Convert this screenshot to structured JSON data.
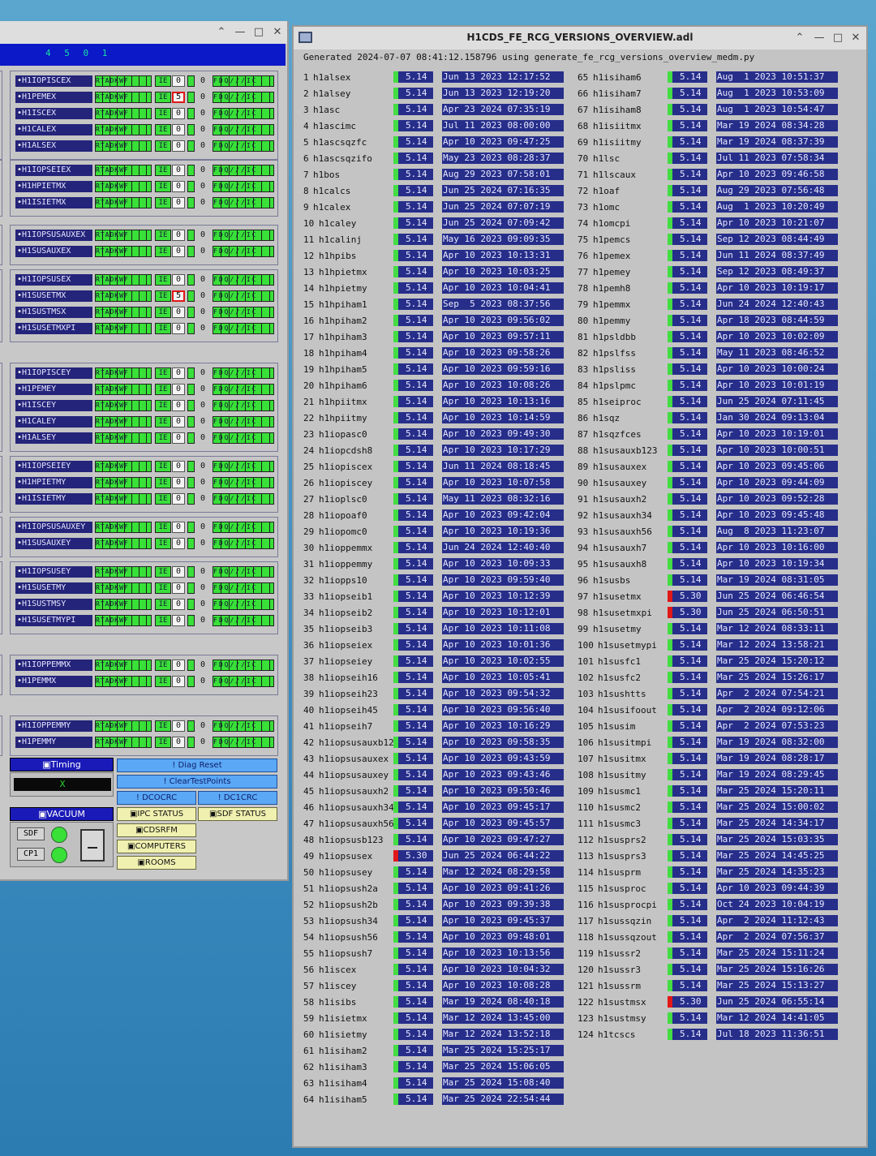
{
  "left_panel": {
    "header_digits": "4 5 0 1",
    "lamp_text": "RTADKWF",
    "ie_text": "IE",
    "rt_text": "FDQ///IC",
    "groups": [
      {
        "rows": [
          {
            "name": "H1IOPISCEX",
            "count": "0",
            "zero": "0"
          },
          {
            "name": "H1PEMEX",
            "count": "5",
            "zero": "0",
            "alert": true
          },
          {
            "name": "H1ISCEX",
            "count": "0",
            "zero": "0"
          },
          {
            "name": "H1CALEX",
            "count": "0",
            "zero": "0"
          },
          {
            "name": "H1ALSEX",
            "count": "0",
            "zero": "0"
          }
        ]
      },
      {
        "rows": [
          {
            "name": "H1IOPSEIEX",
            "count": "0",
            "zero": "0"
          },
          {
            "name": "H1HPIETMX",
            "count": "0",
            "zero": "0"
          },
          {
            "name": "H1ISIETMX",
            "count": "0",
            "zero": "0"
          }
        ]
      },
      {
        "rows": [
          {
            "name": "H1IOPSUSAUXEX",
            "count": "0",
            "zero": "0"
          },
          {
            "name": "H1SUSAUXEX",
            "count": "0",
            "zero": "0"
          }
        ]
      },
      {
        "rows": [
          {
            "name": "H1IOPSUSEX",
            "count": "0",
            "zero": "0"
          },
          {
            "name": "H1SUSETMX",
            "count": "5",
            "zero": "0",
            "alert": true
          },
          {
            "name": "H1SUSTMSX",
            "count": "0",
            "zero": "0"
          },
          {
            "name": "H1SUSETMXPI",
            "count": "0",
            "zero": "0"
          }
        ]
      },
      {
        "rows": [
          {
            "name": "H1IOPISCEY",
            "count": "0",
            "zero": "0"
          },
          {
            "name": "H1PEMEY",
            "count": "0",
            "zero": "0"
          },
          {
            "name": "H1ISCEY",
            "count": "0",
            "zero": "0"
          },
          {
            "name": "H1CALEY",
            "count": "0",
            "zero": "0"
          },
          {
            "name": "H1ALSEY",
            "count": "0",
            "zero": "0"
          }
        ]
      },
      {
        "rows": [
          {
            "name": "H1IOPSEIEY",
            "count": "0",
            "zero": "0"
          },
          {
            "name": "H1HPIETMY",
            "count": "0",
            "zero": "0"
          },
          {
            "name": "H1ISIETMY",
            "count": "0",
            "zero": "0"
          }
        ]
      },
      {
        "rows": [
          {
            "name": "H1IOPSUSAUXEY",
            "count": "0",
            "zero": "0"
          },
          {
            "name": "H1SUSAUXEY",
            "count": "0",
            "zero": "0"
          }
        ]
      },
      {
        "rows": [
          {
            "name": "H1IOPSUSEY",
            "count": "0",
            "zero": "0"
          },
          {
            "name": "H1SUSETMY",
            "count": "0",
            "zero": "0"
          },
          {
            "name": "H1SUSTMSY",
            "count": "0",
            "zero": "0"
          },
          {
            "name": "H1SUSETMYPI",
            "count": "0",
            "zero": "0"
          }
        ]
      },
      {
        "rows": [
          {
            "name": "H1IOPPEMMX",
            "count": "0",
            "zero": "0"
          },
          {
            "name": "H1PEMMX",
            "count": "0",
            "zero": "0"
          }
        ]
      },
      {
        "rows": [
          {
            "name": "H1IOPPEMMY",
            "count": "0",
            "zero": "0"
          },
          {
            "name": "H1PEMMY",
            "count": "0",
            "zero": "0"
          }
        ]
      }
    ],
    "timing_label": "Timing",
    "timing_value": "X",
    "vacuum_label": "VACUUM",
    "sdf_label": "SDF",
    "cp1_label": "CP1",
    "buttons": {
      "diag_reset": "! Diag Reset",
      "clear_test_points": "! ClearTestPoints",
      "dcocrc": "! DCOCRC",
      "dc1crc": "! DC1CRC",
      "ipc_status": "IPC STATUS",
      "sdf_status": "SDF STATUS",
      "cdsrfm": "CDSRFM",
      "computers": "COMPUTERS",
      "rooms": "ROOMS"
    }
  },
  "window": {
    "title": "H1CDS_FE_RCG_VERSIONS_OVERVIEW.adl",
    "generated": "Generated 2024-07-07 08:41:12.158796 using generate_fe_rcg_versions_overview_medm.py"
  },
  "models_left": [
    [
      "1",
      "h1alsex",
      "5.14",
      "Jun 13 2023 12:17:52"
    ],
    [
      "2",
      "h1alsey",
      "5.14",
      "Jun 13 2023 12:19:20"
    ],
    [
      "3",
      "h1asc",
      "5.14",
      "Apr 23 2024 07:35:19"
    ],
    [
      "4",
      "h1ascimc",
      "5.14",
      "Jul 11 2023 08:00:00"
    ],
    [
      "5",
      "h1ascsqzfc",
      "5.14",
      "Apr 10 2023 09:47:25"
    ],
    [
      "6",
      "h1ascsqzifo",
      "5.14",
      "May 23 2023 08:28:37"
    ],
    [
      "7",
      "h1bos",
      "5.14",
      "Aug 29 2023 07:58:01"
    ],
    [
      "8",
      "h1calcs",
      "5.14",
      "Jun 25 2024 07:16:35"
    ],
    [
      "9",
      "h1calex",
      "5.14",
      "Jun 25 2024 07:07:19"
    ],
    [
      "10",
      "h1caley",
      "5.14",
      "Jun 25 2024 07:09:42"
    ],
    [
      "11",
      "h1calinj",
      "5.14",
      "May 16 2023 09:09:35"
    ],
    [
      "12",
      "h1hpibs",
      "5.14",
      "Apr 10 2023 10:13:31"
    ],
    [
      "13",
      "h1hpietmx",
      "5.14",
      "Apr 10 2023 10:03:25"
    ],
    [
      "14",
      "h1hpietmy",
      "5.14",
      "Apr 10 2023 10:04:41"
    ],
    [
      "15",
      "h1hpiham1",
      "5.14",
      "Sep  5 2023 08:37:56"
    ],
    [
      "16",
      "h1hpiham2",
      "5.14",
      "Apr 10 2023 09:56:02"
    ],
    [
      "17",
      "h1hpiham3",
      "5.14",
      "Apr 10 2023 09:57:11"
    ],
    [
      "18",
      "h1hpiham4",
      "5.14",
      "Apr 10 2023 09:58:26"
    ],
    [
      "19",
      "h1hpiham5",
      "5.14",
      "Apr 10 2023 09:59:16"
    ],
    [
      "20",
      "h1hpiham6",
      "5.14",
      "Apr 10 2023 10:08:26"
    ],
    [
      "21",
      "h1hpiitmx",
      "5.14",
      "Apr 10 2023 10:13:16"
    ],
    [
      "22",
      "h1hpiitmy",
      "5.14",
      "Apr 10 2023 10:14:59"
    ],
    [
      "23",
      "h1iopasc0",
      "5.14",
      "Apr 10 2023 09:49:30"
    ],
    [
      "24",
      "h1iopcdsh8",
      "5.14",
      "Apr 10 2023 10:17:29"
    ],
    [
      "25",
      "h1iopiscex",
      "5.14",
      "Jun 11 2024 08:18:45"
    ],
    [
      "26",
      "h1iopiscey",
      "5.14",
      "Apr 10 2023 10:07:58"
    ],
    [
      "27",
      "h1ioplsc0",
      "5.14",
      "May 11 2023 08:32:16"
    ],
    [
      "28",
      "h1iopoaf0",
      "5.14",
      "Apr 10 2023 09:42:04"
    ],
    [
      "29",
      "h1iopomc0",
      "5.14",
      "Apr 10 2023 10:19:36"
    ],
    [
      "30",
      "h1ioppemmx",
      "5.14",
      "Jun 24 2024 12:40:40"
    ],
    [
      "31",
      "h1ioppemmy",
      "5.14",
      "Apr 10 2023 10:09:33"
    ],
    [
      "32",
      "h1iopps10",
      "5.14",
      "Apr 10 2023 09:59:40"
    ],
    [
      "33",
      "h1iopseib1",
      "5.14",
      "Apr 10 2023 10:12:39"
    ],
    [
      "34",
      "h1iopseib2",
      "5.14",
      "Apr 10 2023 10:12:01"
    ],
    [
      "35",
      "h1iopseib3",
      "5.14",
      "Apr 10 2023 10:11:08"
    ],
    [
      "36",
      "h1iopseiex",
      "5.14",
      "Apr 10 2023 10:01:36"
    ],
    [
      "37",
      "h1iopseiey",
      "5.14",
      "Apr 10 2023 10:02:55"
    ],
    [
      "38",
      "h1iopseih16",
      "5.14",
      "Apr 10 2023 10:05:41"
    ],
    [
      "39",
      "h1iopseih23",
      "5.14",
      "Apr 10 2023 09:54:32"
    ],
    [
      "40",
      "h1iopseih45",
      "5.14",
      "Apr 10 2023 09:56:40"
    ],
    [
      "41",
      "h1iopseih7",
      "5.14",
      "Apr 10 2023 10:16:29"
    ],
    [
      "42",
      "h1iopsusauxb123",
      "5.14",
      "Apr 10 2023 09:58:35"
    ],
    [
      "43",
      "h1iopsusauxex",
      "5.14",
      "Apr 10 2023 09:43:59"
    ],
    [
      "44",
      "h1iopsusauxey",
      "5.14",
      "Apr 10 2023 09:43:46"
    ],
    [
      "45",
      "h1iopsusauxh2",
      "5.14",
      "Apr 10 2023 09:50:46"
    ],
    [
      "46",
      "h1iopsusauxh34",
      "5.14",
      "Apr 10 2023 09:45:17"
    ],
    [
      "47",
      "h1iopsusauxh56",
      "5.14",
      "Apr 10 2023 09:45:57"
    ],
    [
      "48",
      "h1iopsusb123",
      "5.14",
      "Apr 10 2023 09:47:27"
    ],
    [
      "49",
      "h1iopsusex",
      "5.30",
      "Jun 25 2024 06:44:22"
    ],
    [
      "50",
      "h1iopsusey",
      "5.14",
      "Mar 12 2024 08:29:58"
    ],
    [
      "51",
      "h1iopsush2a",
      "5.14",
      "Apr 10 2023 09:41:26"
    ],
    [
      "52",
      "h1iopsush2b",
      "5.14",
      "Apr 10 2023 09:39:38"
    ],
    [
      "53",
      "h1iopsush34",
      "5.14",
      "Apr 10 2023 09:45:37"
    ],
    [
      "54",
      "h1iopsush56",
      "5.14",
      "Apr 10 2023 09:48:01"
    ],
    [
      "55",
      "h1iopsush7",
      "5.14",
      "Apr 10 2023 10:13:56"
    ],
    [
      "56",
      "h1iscex",
      "5.14",
      "Apr 10 2023 10:04:32"
    ],
    [
      "57",
      "h1iscey",
      "5.14",
      "Apr 10 2023 10:08:28"
    ],
    [
      "58",
      "h1isibs",
      "5.14",
      "Mar 19 2024 08:40:18"
    ],
    [
      "59",
      "h1isietmx",
      "5.14",
      "Mar 12 2024 13:45:00"
    ],
    [
      "60",
      "h1isietmy",
      "5.14",
      "Mar 12 2024 13:52:18"
    ],
    [
      "61",
      "h1isiham2",
      "5.14",
      "Mar 25 2024 15:25:17"
    ],
    [
      "62",
      "h1isiham3",
      "5.14",
      "Mar 25 2024 15:06:05"
    ],
    [
      "63",
      "h1isiham4",
      "5.14",
      "Mar 25 2024 15:08:40"
    ],
    [
      "64",
      "h1isiham5",
      "5.14",
      "Mar 25 2024 22:54:44"
    ]
  ],
  "models_right": [
    [
      "65",
      "h1isiham6",
      "5.14",
      "Aug  1 2023 10:51:37"
    ],
    [
      "66",
      "h1isiham7",
      "5.14",
      "Aug  1 2023 10:53:09"
    ],
    [
      "67",
      "h1isiham8",
      "5.14",
      "Aug  1 2023 10:54:47"
    ],
    [
      "68",
      "h1isiitmx",
      "5.14",
      "Mar 19 2024 08:34:28"
    ],
    [
      "69",
      "h1isiitmy",
      "5.14",
      "Mar 19 2024 08:37:39"
    ],
    [
      "70",
      "h1lsc",
      "5.14",
      "Jul 11 2023 07:58:34"
    ],
    [
      "71",
      "h1lscaux",
      "5.14",
      "Apr 10 2023 09:46:58"
    ],
    [
      "72",
      "h1oaf",
      "5.14",
      "Aug 29 2023 07:56:48"
    ],
    [
      "73",
      "h1omc",
      "5.14",
      "Aug  1 2023 10:20:49"
    ],
    [
      "74",
      "h1omcpi",
      "5.14",
      "Apr 10 2023 10:21:07"
    ],
    [
      "75",
      "h1pemcs",
      "5.14",
      "Sep 12 2023 08:44:49"
    ],
    [
      "76",
      "h1pemex",
      "5.14",
      "Jun 11 2024 08:37:49"
    ],
    [
      "77",
      "h1pemey",
      "5.14",
      "Sep 12 2023 08:49:37"
    ],
    [
      "78",
      "h1pemh8",
      "5.14",
      "Apr 10 2023 10:19:17"
    ],
    [
      "79",
      "h1pemmx",
      "5.14",
      "Jun 24 2024 12:40:43"
    ],
    [
      "80",
      "h1pemmy",
      "5.14",
      "Apr 18 2023 08:44:59"
    ],
    [
      "81",
      "h1psldbb",
      "5.14",
      "Apr 10 2023 10:02:09"
    ],
    [
      "82",
      "h1pslfss",
      "5.14",
      "May 11 2023 08:46:52"
    ],
    [
      "83",
      "h1psliss",
      "5.14",
      "Apr 10 2023 10:00:24"
    ],
    [
      "84",
      "h1pslpmc",
      "5.14",
      "Apr 10 2023 10:01:19"
    ],
    [
      "85",
      "h1seiproc",
      "5.14",
      "Jun 25 2024 07:11:45"
    ],
    [
      "86",
      "h1sqz",
      "5.14",
      "Jan 30 2024 09:13:04"
    ],
    [
      "87",
      "h1sqzfces",
      "5.14",
      "Apr 10 2023 10:19:01"
    ],
    [
      "88",
      "h1susauxb123",
      "5.14",
      "Apr 10 2023 10:00:51"
    ],
    [
      "89",
      "h1susauxex",
      "5.14",
      "Apr 10 2023 09:45:06"
    ],
    [
      "90",
      "h1susauxey",
      "5.14",
      "Apr 10 2023 09:44:09"
    ],
    [
      "91",
      "h1susauxh2",
      "5.14",
      "Apr 10 2023 09:52:28"
    ],
    [
      "92",
      "h1susauxh34",
      "5.14",
      "Apr 10 2023 09:45:48"
    ],
    [
      "93",
      "h1susauxh56",
      "5.14",
      "Aug  8 2023 11:23:07"
    ],
    [
      "94",
      "h1susauxh7",
      "5.14",
      "Apr 10 2023 10:16:00"
    ],
    [
      "95",
      "h1susauxh8",
      "5.14",
      "Apr 10 2023 10:19:34"
    ],
    [
      "96",
      "h1susbs",
      "5.14",
      "Mar 19 2024 08:31:05"
    ],
    [
      "97",
      "h1susetmx",
      "5.30",
      "Jun 25 2024 06:46:54"
    ],
    [
      "98",
      "h1susetmxpi",
      "5.30",
      "Jun 25 2024 06:50:51"
    ],
    [
      "99",
      "h1susetmy",
      "5.14",
      "Mar 12 2024 08:33:11"
    ],
    [
      "100",
      "h1susetmypi",
      "5.14",
      "Mar 12 2024 13:58:21"
    ],
    [
      "101",
      "h1susfc1",
      "5.14",
      "Mar 25 2024 15:20:12"
    ],
    [
      "102",
      "h1susfc2",
      "5.14",
      "Mar 25 2024 15:26:17"
    ],
    [
      "103",
      "h1sushtts",
      "5.14",
      "Apr  2 2024 07:54:21"
    ],
    [
      "104",
      "h1susifoout",
      "5.14",
      "Apr  2 2024 09:12:06"
    ],
    [
      "105",
      "h1susim",
      "5.14",
      "Apr  2 2024 07:53:23"
    ],
    [
      "106",
      "h1susitmpi",
      "5.14",
      "Mar 19 2024 08:32:00"
    ],
    [
      "107",
      "h1susitmx",
      "5.14",
      "Mar 19 2024 08:28:17"
    ],
    [
      "108",
      "h1susitmy",
      "5.14",
      "Mar 19 2024 08:29:45"
    ],
    [
      "109",
      "h1susmc1",
      "5.14",
      "Mar 25 2024 15:20:11"
    ],
    [
      "110",
      "h1susmc2",
      "5.14",
      "Mar 25 2024 15:00:02"
    ],
    [
      "111",
      "h1susmc3",
      "5.14",
      "Mar 25 2024 14:34:17"
    ],
    [
      "112",
      "h1susprs2",
      "5.14",
      "Mar 25 2024 15:03:35"
    ],
    [
      "113",
      "h1susprs3",
      "5.14",
      "Mar 25 2024 14:45:25"
    ],
    [
      "114",
      "h1susprm",
      "5.14",
      "Mar 25 2024 14:35:23"
    ],
    [
      "115",
      "h1susproc",
      "5.14",
      "Apr 10 2023 09:44:39"
    ],
    [
      "116",
      "h1susprocpi",
      "5.14",
      "Oct 24 2023 10:04:19"
    ],
    [
      "117",
      "h1sussqzin",
      "5.14",
      "Apr  2 2024 11:12:43"
    ],
    [
      "118",
      "h1sussqzout",
      "5.14",
      "Apr  2 2024 07:56:37"
    ],
    [
      "119",
      "h1sussr2",
      "5.14",
      "Mar 25 2024 15:11:24"
    ],
    [
      "120",
      "h1sussr3",
      "5.14",
      "Mar 25 2024 15:16:26"
    ],
    [
      "121",
      "h1sussrm",
      "5.14",
      "Mar 25 2024 15:13:27"
    ],
    [
      "122",
      "h1sustmsx",
      "5.30",
      "Jun 25 2024 06:55:14"
    ],
    [
      "123",
      "h1sustmsy",
      "5.14",
      "Mar 12 2024 14:41:05"
    ],
    [
      "124",
      "h1tcscs",
      "5.14",
      "Jul 18 2023 11:36:51"
    ]
  ],
  "colors": {
    "current_version": "#43dd43",
    "new_version": "#e01818",
    "panel_blue": "#262e8a"
  }
}
